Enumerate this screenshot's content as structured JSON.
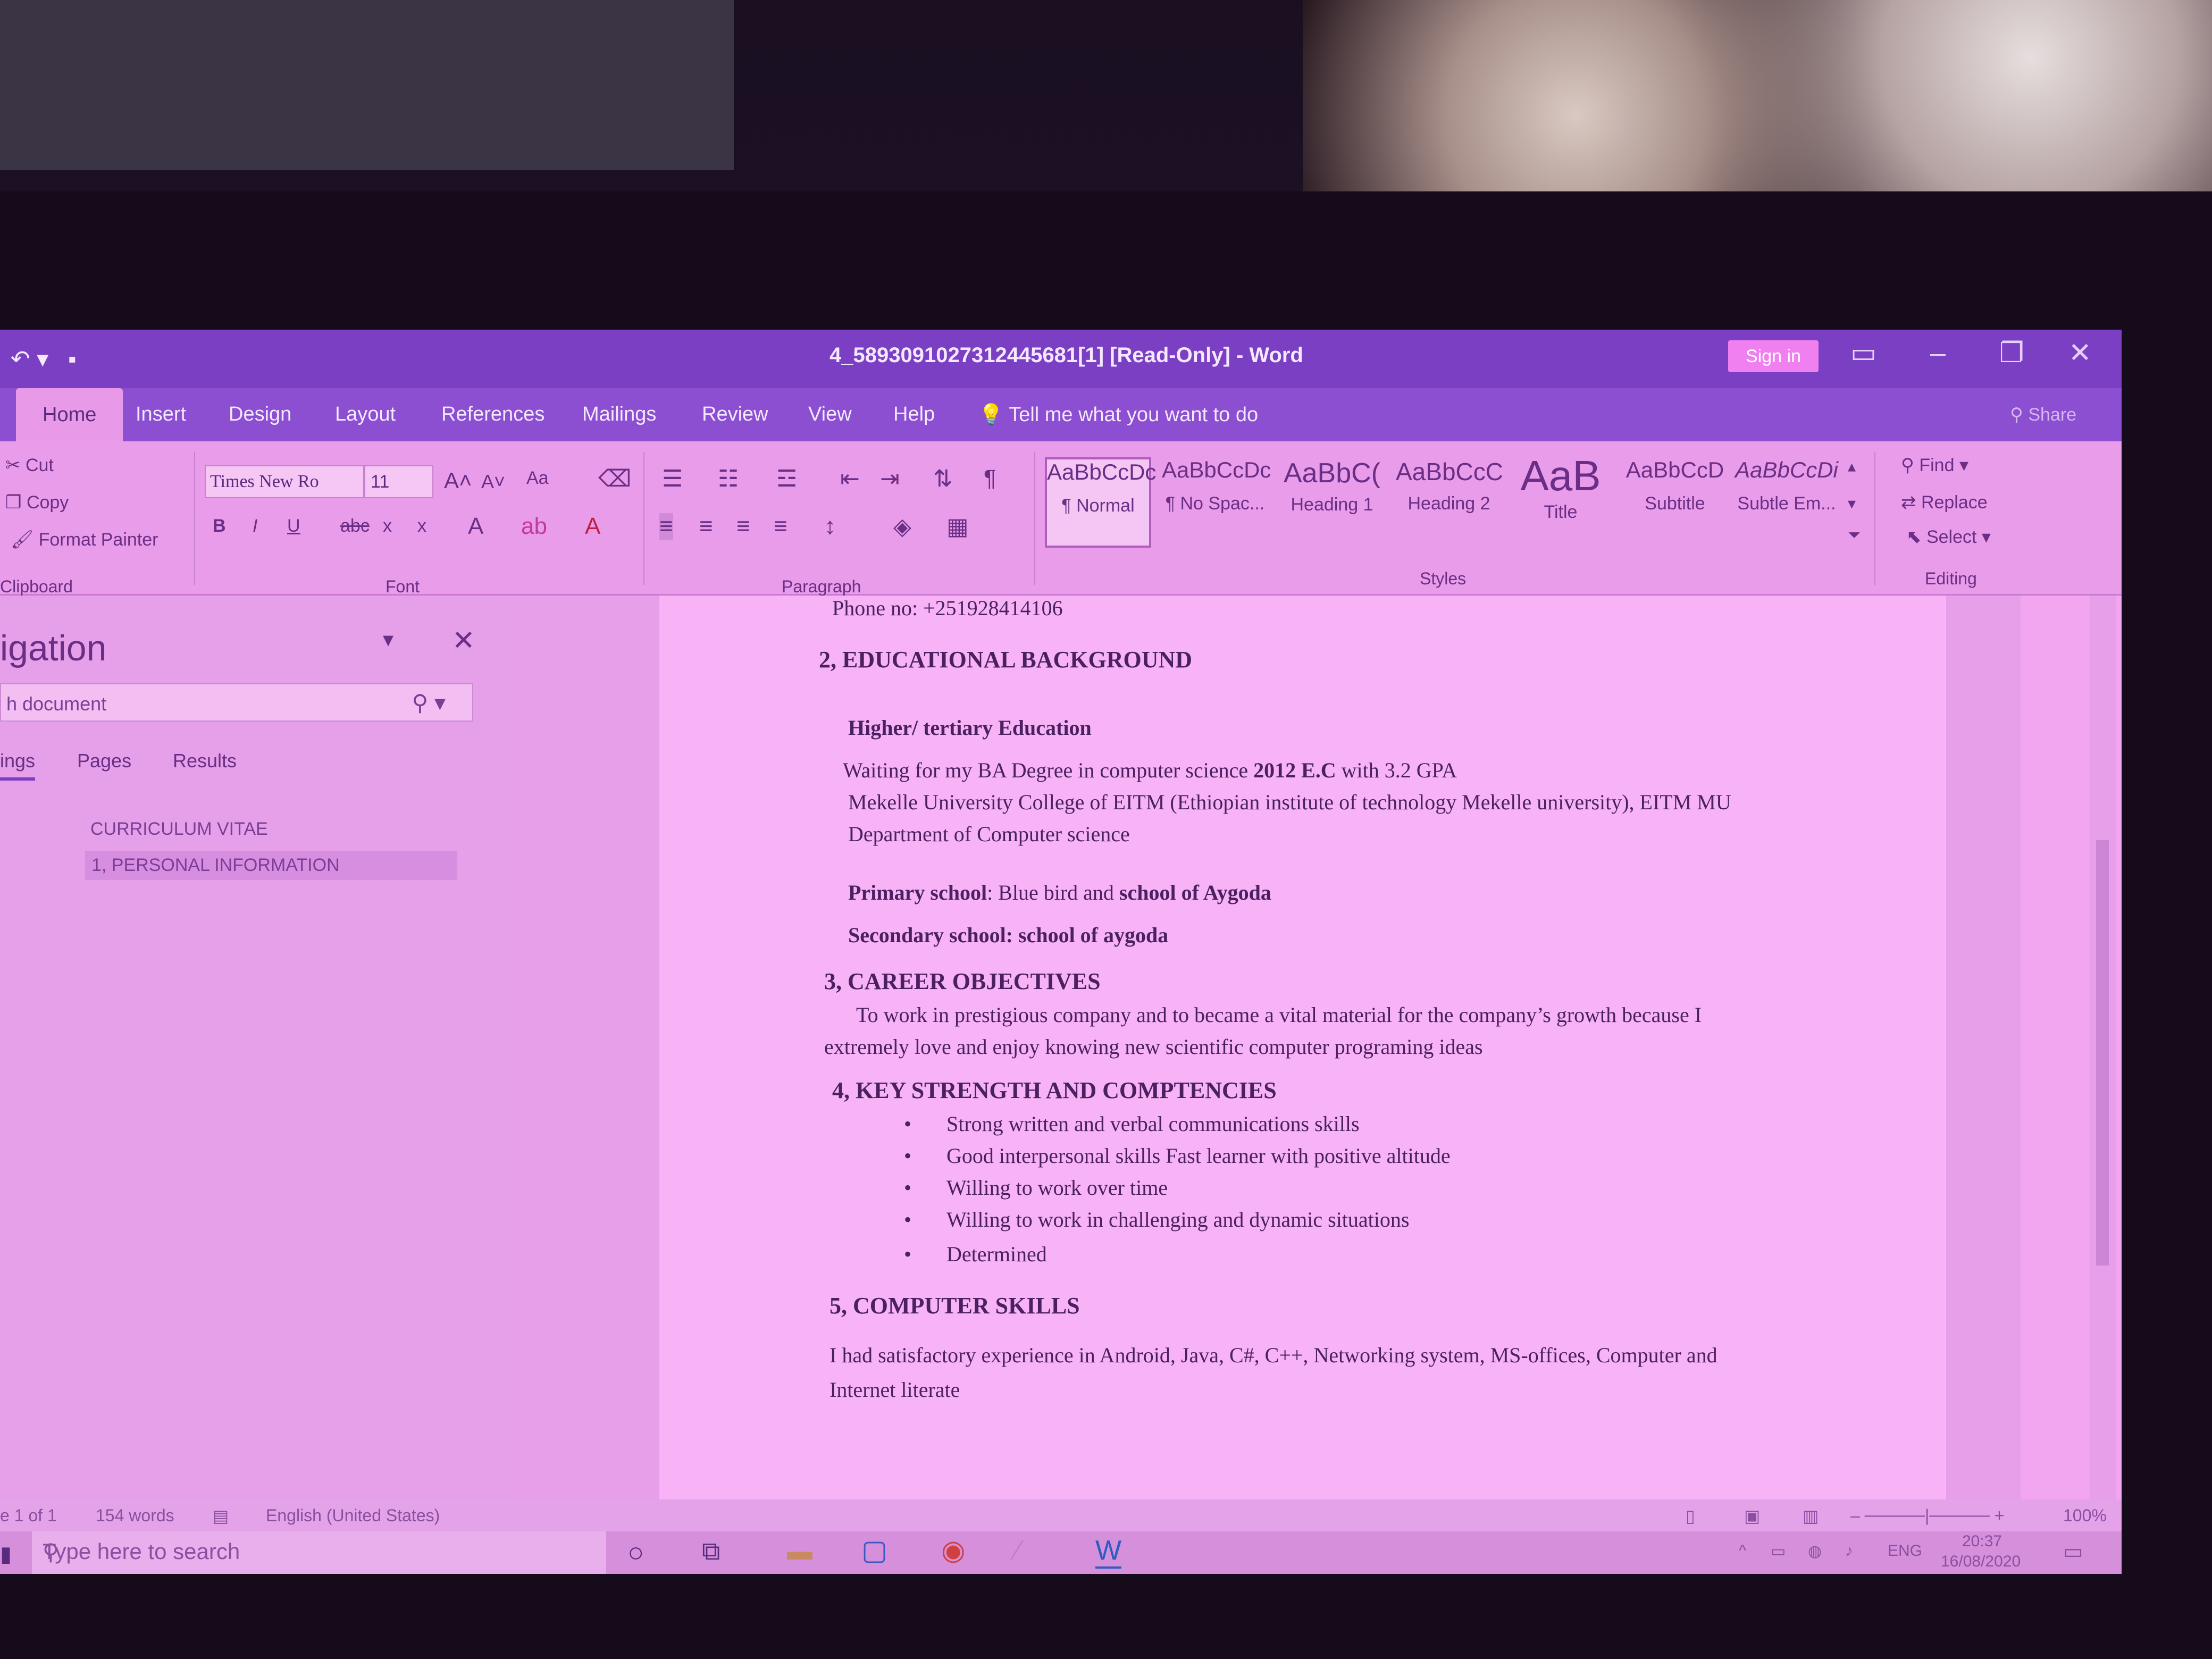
{
  "window": {
    "title": "4_5893091027312445681[1] [Read-Only] - Word",
    "sign_in": "Sign in",
    "share": "Share"
  },
  "tabs": [
    "Home",
    "Insert",
    "Design",
    "Layout",
    "References",
    "Mailings",
    "Review",
    "View",
    "Help"
  ],
  "tell_me": "Tell me what you want to do",
  "ribbon": {
    "clipboard": {
      "cut": "Cut",
      "copy": "Copy",
      "format_painter": "Format Painter",
      "label": "Clipboard"
    },
    "font": {
      "family": "Times New Ro",
      "size": "11",
      "label": "Font",
      "case": "Aa",
      "bold": "B",
      "italic": "I",
      "underline": "U",
      "strike": "abc",
      "sub": "x",
      "sup": "x"
    },
    "paragraph": {
      "label": "Paragraph"
    },
    "styles": {
      "label": "Styles",
      "items": [
        {
          "sample": "AaBbCcDc",
          "name": "¶ Normal"
        },
        {
          "sample": "AaBbCcDc",
          "name": "¶ No Spac..."
        },
        {
          "sample": "AaBbC(",
          "name": "Heading 1"
        },
        {
          "sample": "AaBbCcC",
          "name": "Heading 2"
        },
        {
          "sample": "AaB",
          "name": "Title"
        },
        {
          "sample": "AaBbCcD",
          "name": "Subtitle"
        },
        {
          "sample": "AaBbCcDi",
          "name": "Subtle Em..."
        }
      ]
    },
    "editing": {
      "find": "Find",
      "replace": "Replace",
      "select": "Select",
      "label": "Editing"
    }
  },
  "nav": {
    "title": "igation",
    "search_placeholder": "h document",
    "tabs": [
      "ings",
      "Pages",
      "Results"
    ],
    "headings": [
      "CURRICULUM VITAE",
      "1, PERSONAL INFORMATION"
    ]
  },
  "document": {
    "phone": "Phone no: +251928414106",
    "s2": "2, EDUCATIONAL BACKGROUND",
    "higher": "Higher/ tertiary Education",
    "waiting_a": "Waiting for my BA Degree in computer science ",
    "waiting_b": "2012 E.C",
    "waiting_c": " with 3.2 GPA",
    "mekelle": "Mekelle University College of EITM (Ethiopian institute of technology Mekelle university), EITM MU",
    "dept": "Department of Computer science",
    "primary_a": "Primary school",
    "primary_b": ": Blue bird and ",
    "primary_c": "school of Aygoda",
    "secondary": "Secondary school: school of aygoda",
    "s3": "3, CAREER OBJECTIVES",
    "career1": "To work in prestigious company and to became a vital material for the company’s growth because I",
    "career2": "extremely love and enjoy knowing new scientific computer programing ideas",
    "s4": "4, KEY STRENGTH AND COMPTENCIES",
    "strengths": [
      "Strong written and verbal communications skills",
      "Good interpersonal skills Fast learner with positive altitude",
      "Willing to work over time",
      "Willing to work in challenging and dynamic situations",
      "Determined"
    ],
    "s5": "5, COMPUTER SKILLS",
    "skills1": "I had satisfactory experience in Android, Java, C#, C++, Networking system, MS-offices, Computer and",
    "skills2": "Internet literate"
  },
  "status": {
    "page": "e 1 of 1",
    "words": "154 words",
    "language": "English (United States)",
    "zoom": "100%"
  },
  "taskbar": {
    "search_placeholder": "Type here to search",
    "lang": "ENG",
    "time": "20:37",
    "date": "16/08/2020"
  }
}
